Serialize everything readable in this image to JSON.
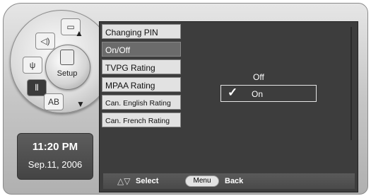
{
  "dial": {
    "center_label": "Setup",
    "wedge_ab": "AB"
  },
  "clock": {
    "time": "11:20 PM",
    "date": "Sep.11, 2006"
  },
  "menu": {
    "items": [
      {
        "label": "Changing PIN",
        "selected": false
      },
      {
        "label": "On/Off",
        "selected": true
      },
      {
        "label": "TVPG Rating",
        "selected": false
      },
      {
        "label": "MPAA Rating",
        "selected": false
      },
      {
        "label": "Can. English Rating",
        "selected": false
      },
      {
        "label": "Can. French Rating",
        "selected": false
      }
    ]
  },
  "options": {
    "off_label": "Off",
    "on_label": "On",
    "checked": "On"
  },
  "footer": {
    "select_label": "Select",
    "menu_button": "Menu",
    "back_label": "Back"
  },
  "colors": {
    "panel": "#3d3d3d",
    "selected_item": "#6b6b6b",
    "item_bg": "#e2e2e2"
  }
}
